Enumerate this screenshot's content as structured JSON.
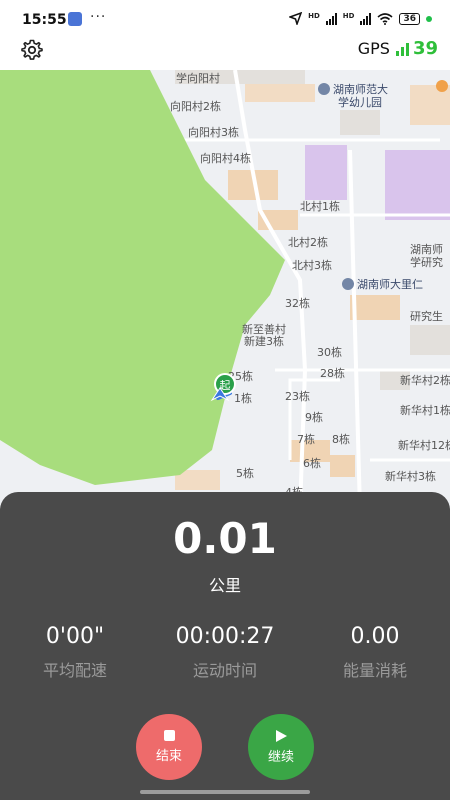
{
  "status_bar": {
    "time": "15:55",
    "more": "···",
    "network_1": "HD",
    "network_2": "HD",
    "battery": "36",
    "app_badge_icon": "app-icon",
    "location_icon": "navigation-arrow-icon",
    "wifi_icon": "wifi-icon",
    "charging_dot_color": "#1fbf4a"
  },
  "top_bar": {
    "settings_icon": "gear-icon",
    "gps_label": "GPS",
    "gps_count": "39",
    "gps_color": "#2fbf3a"
  },
  "map": {
    "labels": [
      "学向阳村",
      "向阳村2栋",
      "向阳村3栋",
      "向阳村4栋",
      "北村1栋",
      "北村2栋",
      "北村3栋",
      "32栋",
      "新至善村",
      "新建3栋",
      "30栋",
      "28栋",
      "23栋",
      "9栋",
      "7栋",
      "8栋",
      "6栋",
      "5栋",
      "4栋",
      "新华村2栋",
      "新华村1栋",
      "新华村12栋",
      "新华村3栋",
      "研究生",
      "湖南师",
      "学研究",
      "25栋",
      "1栋"
    ],
    "poi_kindergarten": [
      "湖南师范大",
      "学幼儿园"
    ],
    "poi_hotel": "湖南师大里仁",
    "start_marker": "起",
    "park_color": "#a8dd7d"
  },
  "panel": {
    "distance_value": "0.01",
    "distance_unit": "公里",
    "stats": [
      {
        "value": "0'00\"",
        "label": "平均配速"
      },
      {
        "value": "00:00:27",
        "label": "运动时间"
      },
      {
        "value": "0.00",
        "label": "能量消耗"
      }
    ],
    "stop_label": "结束",
    "continue_label": "继续",
    "stop_color": "#ee6b6b",
    "continue_color": "#3aa646"
  }
}
